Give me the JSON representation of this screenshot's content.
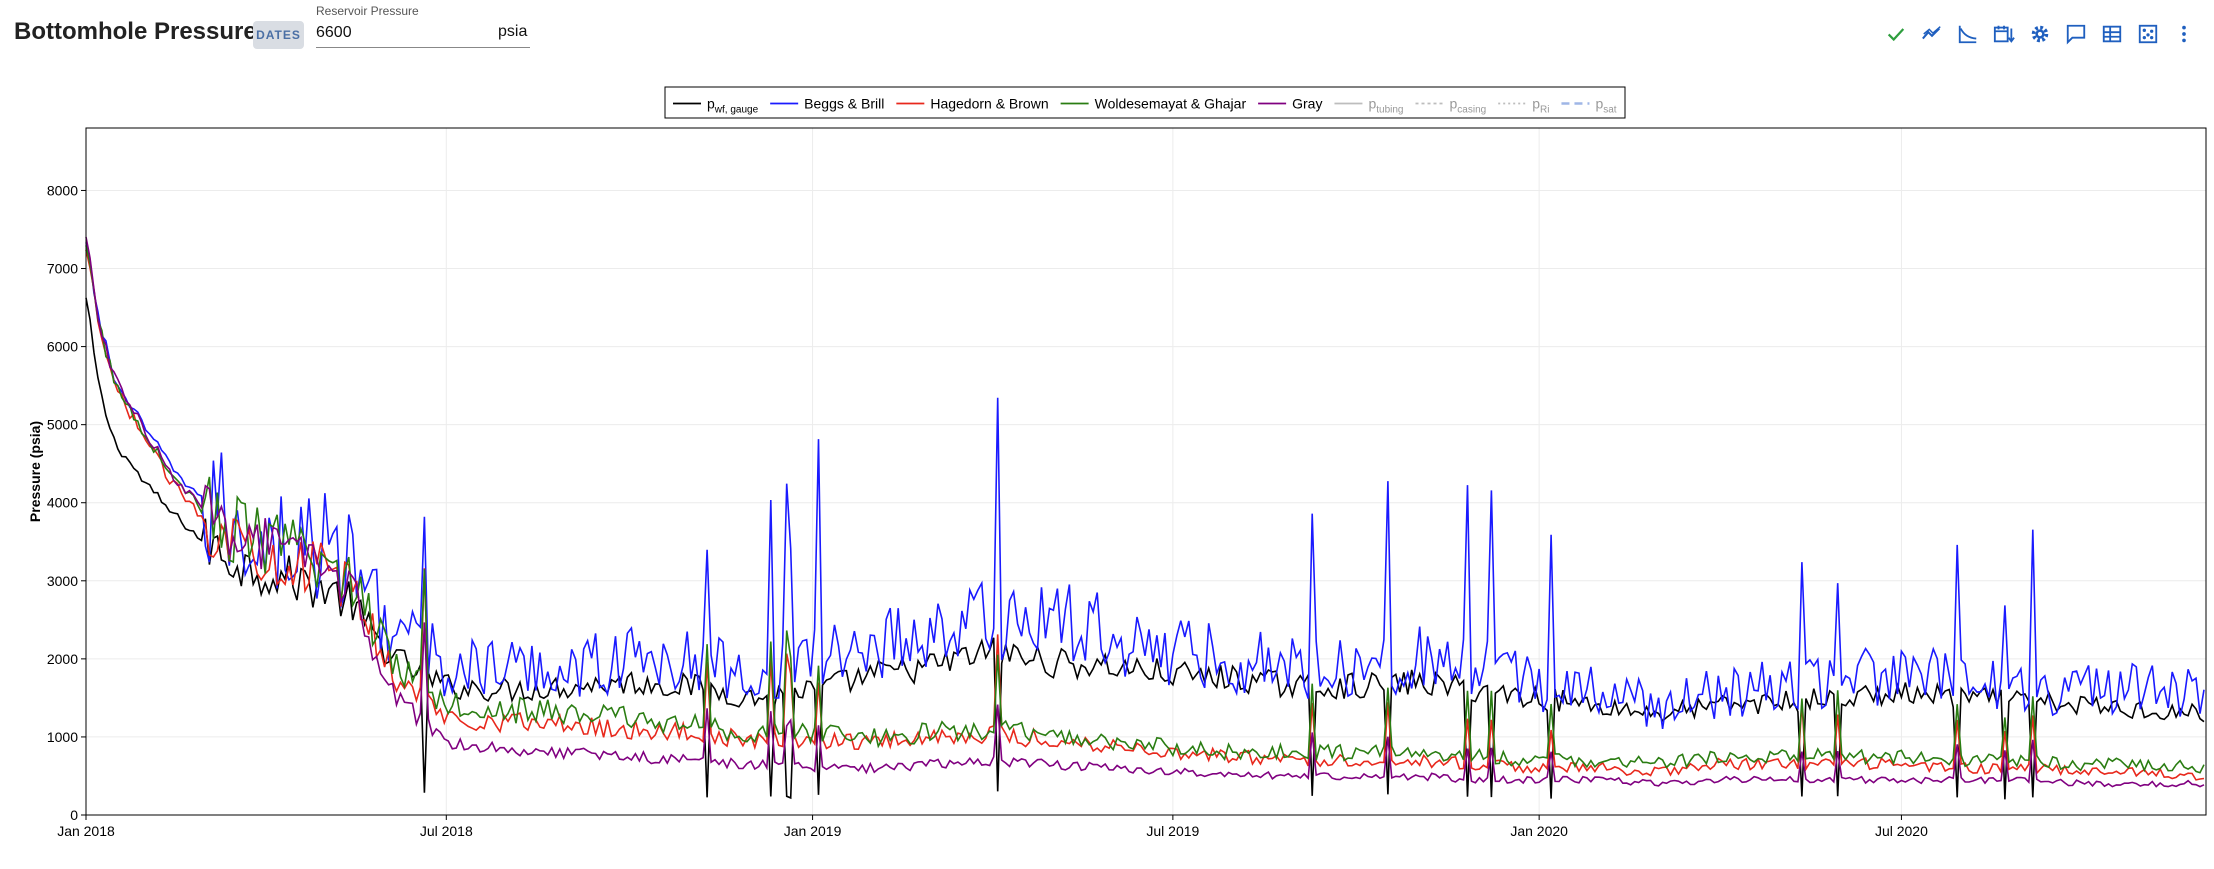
{
  "header": {
    "title": "Bottomhole Pressure",
    "dates_label": "DATES",
    "reservoir_pressure": {
      "label": "Reservoir Pressure",
      "value": "6600",
      "unit": "psia"
    }
  },
  "toolbar": {
    "icons": [
      "check-icon",
      "trend-icon",
      "decline-curve-icon",
      "calendar-sort-icon",
      "gear-icon",
      "comment-icon",
      "table-icon",
      "scatter-icon",
      "more-vertical-icon"
    ]
  },
  "colors": {
    "accent": "#1f5fbf",
    "check": "#2e9e3e",
    "gauge": "#000000",
    "beggs": "#1a1aff",
    "hagedorn": "#e8281c",
    "woldesemayat": "#2a7d12",
    "gray": "#800080",
    "faded": "#bdbdbd",
    "psat": "#9fb6e6"
  },
  "chart_data": {
    "type": "line",
    "ylabel": "Pressure (psia)",
    "ylim": [
      0,
      8800
    ],
    "yticks": [
      0,
      1000,
      2000,
      3000,
      4000,
      5000,
      6000,
      7000,
      8000
    ],
    "xlim": [
      "2018-01-01",
      "2020-12-01"
    ],
    "xticks": [
      {
        "date": "2018-01-01",
        "label": "Jan 2018"
      },
      {
        "date": "2018-07-01",
        "label": "Jul 2018"
      },
      {
        "date": "2019-01-01",
        "label": "Jan 2019"
      },
      {
        "date": "2019-07-01",
        "label": "Jul 2019"
      },
      {
        "date": "2020-01-01",
        "label": "Jan 2020"
      },
      {
        "date": "2020-07-01",
        "label": "Jul 2020"
      }
    ],
    "grid": true,
    "legend_position": "top-center",
    "x": [
      "2018-01-01",
      "2018-01-08",
      "2018-01-15",
      "2018-01-29",
      "2018-02-12",
      "2018-03-01",
      "2018-03-20",
      "2018-04-10",
      "2018-05-01",
      "2018-05-15",
      "2018-05-22",
      "2018-06-05",
      "2018-06-19",
      "2018-07-01",
      "2018-08-01",
      "2018-09-01",
      "2018-10-01",
      "2018-11-01",
      "2018-12-01",
      "2019-01-01",
      "2019-02-01",
      "2019-03-01",
      "2019-04-01",
      "2019-05-01",
      "2019-06-01",
      "2019-07-01",
      "2019-08-01",
      "2019-09-01",
      "2019-10-01",
      "2019-11-01",
      "2019-12-01",
      "2020-01-01",
      "2020-02-01",
      "2020-03-01",
      "2020-04-01",
      "2020-05-01",
      "2020-06-01",
      "2020-07-01",
      "2020-08-01",
      "2020-09-01",
      "2020-10-01",
      "2020-11-01",
      "2020-12-01"
    ],
    "series": [
      {
        "name": "p_wf, gauge",
        "label_main": "p",
        "label_sub": "wf, gauge",
        "color": "#000000",
        "values": [
          6600,
          5400,
          4800,
          4300,
          3900,
          3500,
          3200,
          3050,
          2900,
          2700,
          2400,
          2000,
          1800,
          1650,
          1600,
          1650,
          1700,
          1650,
          1500,
          1600,
          1800,
          1900,
          2100,
          1950,
          1900,
          1800,
          1750,
          1650,
          1650,
          1700,
          1600,
          1500,
          1400,
          1300,
          1400,
          1450,
          1500,
          1550,
          1500,
          1450,
          1400,
          1350,
          1300
        ]
      },
      {
        "name": "Beggs & Brill",
        "color": "#1a1aff",
        "values": [
          7300,
          6300,
          5600,
          5000,
          4500,
          4000,
          3700,
          3500,
          3400,
          3200,
          2900,
          2400,
          2100,
          1900,
          1850,
          1900,
          2000,
          1950,
          1800,
          2000,
          2200,
          2350,
          2500,
          2500,
          2300,
          2100,
          2000,
          1900,
          1950,
          2000,
          1850,
          1700,
          1550,
          1400,
          1550,
          1650,
          1750,
          1800,
          1700,
          1650,
          1600,
          1600,
          1500
        ]
      },
      {
        "name": "Hagedorn & Brown",
        "color": "#e8281c",
        "values": [
          7200,
          6200,
          5500,
          4900,
          4300,
          3800,
          3500,
          3300,
          3100,
          2900,
          2500,
          1800,
          1500,
          1250,
          1200,
          1150,
          1100,
          1050,
          950,
          950,
          950,
          1000,
          1050,
          950,
          900,
          800,
          750,
          700,
          700,
          700,
          650,
          600,
          600,
          550,
          650,
          650,
          650,
          650,
          600,
          600,
          550,
          550,
          500
        ]
      },
      {
        "name": "Woldesemayat & Ghajar",
        "color": "#2a7d12",
        "values": [
          7250,
          6250,
          5550,
          4950,
          4400,
          3900,
          3600,
          3400,
          3200,
          3000,
          2600,
          2000,
          1700,
          1450,
          1350,
          1300,
          1250,
          1150,
          1050,
          1050,
          1000,
          1050,
          1100,
          1000,
          950,
          850,
          800,
          800,
          800,
          800,
          750,
          700,
          700,
          650,
          750,
          750,
          750,
          750,
          700,
          700,
          650,
          650,
          600
        ]
      },
      {
        "name": "Gray",
        "color": "#800080",
        "values": [
          7350,
          6300,
          5600,
          5000,
          4400,
          3900,
          3600,
          3350,
          3150,
          2900,
          2300,
          1500,
          1200,
          950,
          850,
          800,
          750,
          700,
          650,
          600,
          600,
          650,
          700,
          650,
          600,
          550,
          500,
          500,
          500,
          500,
          450,
          450,
          450,
          400,
          450,
          450,
          450,
          450,
          450,
          450,
          400,
          400,
          400
        ]
      },
      {
        "name": "p_tubing",
        "label_main": "p",
        "label_sub": "tubing",
        "color": "#bdbdbd",
        "values": []
      },
      {
        "name": "p_casing",
        "label_main": "p",
        "label_sub": "casing",
        "color": "#bdbdbd",
        "values": []
      },
      {
        "name": "p_Ri",
        "label_main": "p",
        "label_sub": "Ri",
        "color": "#bdbdbd",
        "values": []
      },
      {
        "name": "p_sat",
        "label_main": "p",
        "label_sub": "sat",
        "color": "#9fb6e6",
        "values": []
      }
    ]
  }
}
